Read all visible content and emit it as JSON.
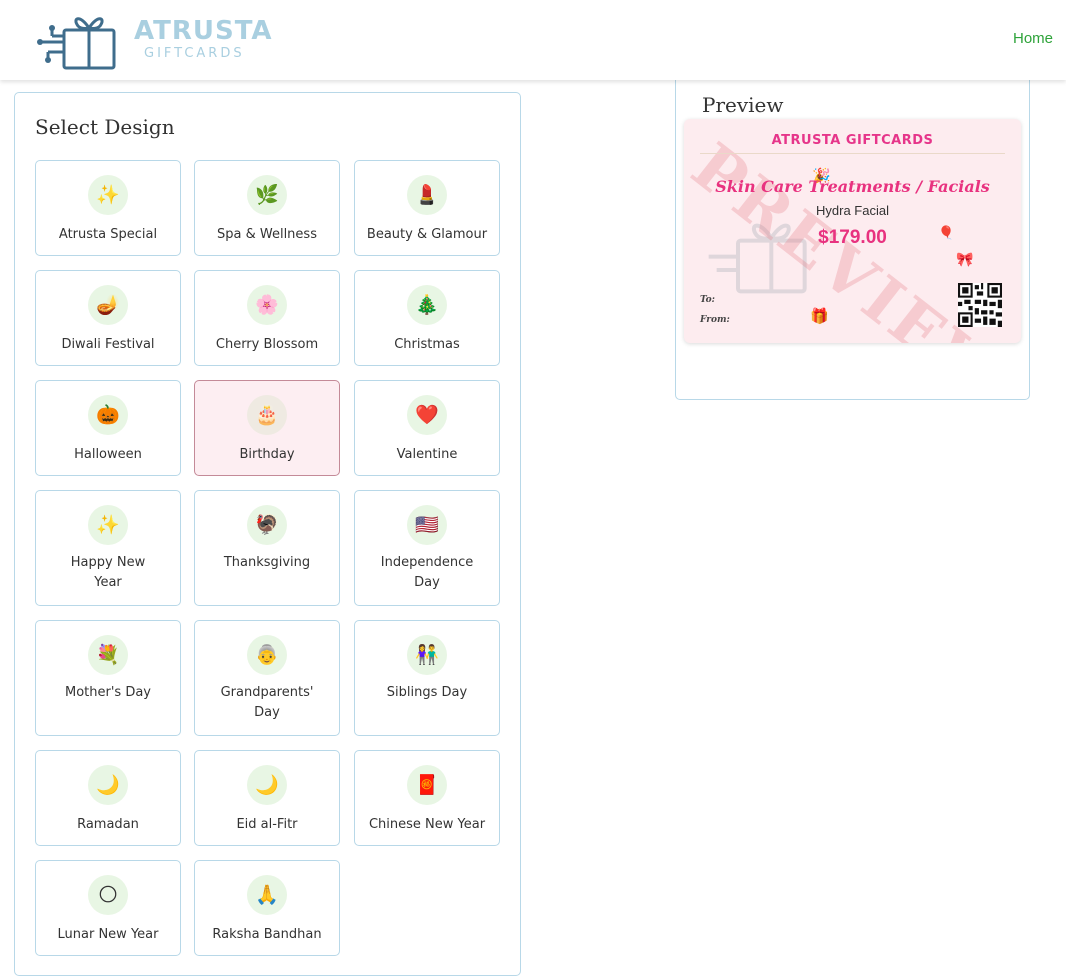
{
  "header": {
    "logo_main": "ATRUSTA",
    "logo_sub": "GIFTCARDS",
    "nav_home": "Home",
    "logo_color": "#a9cfe0",
    "nav_color": "#2ea33a"
  },
  "design_panel": {
    "title": "Select Design",
    "selected": "Birthday",
    "designs": [
      {
        "label": "Atrusta Special",
        "icon": "sparkles-icon",
        "glyph": "✨"
      },
      {
        "label": "Spa & Wellness",
        "icon": "leaf-icon",
        "glyph": "🌿"
      },
      {
        "label": "Beauty & Glamour",
        "icon": "lipstick-icon",
        "glyph": "💄"
      },
      {
        "label": "Diwali Festival",
        "icon": "diya-lamp-icon",
        "glyph": "🪔"
      },
      {
        "label": "Cherry Blossom",
        "icon": "cherry-blossom-icon",
        "glyph": "🌸"
      },
      {
        "label": "Christmas",
        "icon": "christmas-tree-icon",
        "glyph": "🎄"
      },
      {
        "label": "Halloween",
        "icon": "pumpkin-icon",
        "glyph": "🎃"
      },
      {
        "label": "Birthday",
        "icon": "birthday-cake-icon",
        "glyph": "🎂"
      },
      {
        "label": "Valentine",
        "icon": "heart-icon",
        "glyph": "❤️"
      },
      {
        "label": "Happy New Year",
        "icon": "sparkles-icon",
        "glyph": "✨"
      },
      {
        "label": "Thanksgiving",
        "icon": "turkey-icon",
        "glyph": "🦃"
      },
      {
        "label": "Independence Day",
        "icon": "us-flag-icon",
        "glyph": "🇺🇸"
      },
      {
        "label": "Mother's Day",
        "icon": "bouquet-icon",
        "glyph": "💐"
      },
      {
        "label": "Grandparents' Day",
        "icon": "grandparent-icon",
        "glyph": "👵"
      },
      {
        "label": "Siblings Day",
        "icon": "siblings-icon",
        "glyph": "👫"
      },
      {
        "label": "Ramadan",
        "icon": "crescent-moon-icon",
        "glyph": "🌙"
      },
      {
        "label": "Eid al-Fitr",
        "icon": "crescent-moon-icon",
        "glyph": "🌙"
      },
      {
        "label": "Chinese New Year",
        "icon": "red-envelope-icon",
        "glyph": "🧧"
      },
      {
        "label": "Lunar New Year",
        "icon": "full-moon-icon",
        "glyph": "🌕"
      },
      {
        "label": "Raksha Bandhan",
        "icon": "folded-hands-icon",
        "glyph": "🙏"
      }
    ]
  },
  "preview": {
    "title": "Preview",
    "card": {
      "brand": "ATRUSTA GIFTCARDS",
      "watermark": "PREVIEW",
      "category": "Skin Care Treatments / Facials",
      "service": "Hydra Facial",
      "price": "$179.00",
      "to_label": "To:",
      "from_label": "From:",
      "accent_color": "#e8327f",
      "background_color": "#fdecef"
    }
  }
}
